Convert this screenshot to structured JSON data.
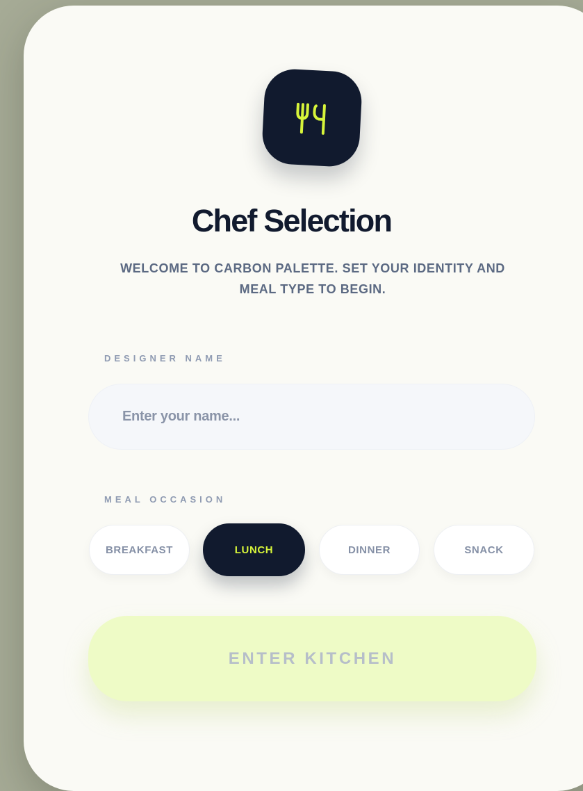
{
  "app": {
    "title": "Chef Selection",
    "subtitle": "WELCOME TO CARBON PALETTE. SET YOUR IDENTITY AND MEAL TYPE TO BEGIN.",
    "logo_icon": "utensils-icon"
  },
  "form": {
    "name_label": "DESIGNER NAME",
    "name_value": "",
    "name_placeholder": "Enter your name...",
    "meal_label": "MEAL OCCASION",
    "meal_options": [
      {
        "label": "BREAKFAST",
        "selected": false
      },
      {
        "label": "LUNCH",
        "selected": true
      },
      {
        "label": "DINNER",
        "selected": false
      },
      {
        "label": "SNACK",
        "selected": false
      }
    ],
    "submit_label": "ENTER KITCHEN"
  },
  "colors": {
    "background": "#a6ab96",
    "card": "#fafaf5",
    "primary_dark": "#111a2e",
    "accent_lime": "#d7f43a",
    "button_bg": "#eefbc6",
    "muted_text": "#5b6982"
  }
}
